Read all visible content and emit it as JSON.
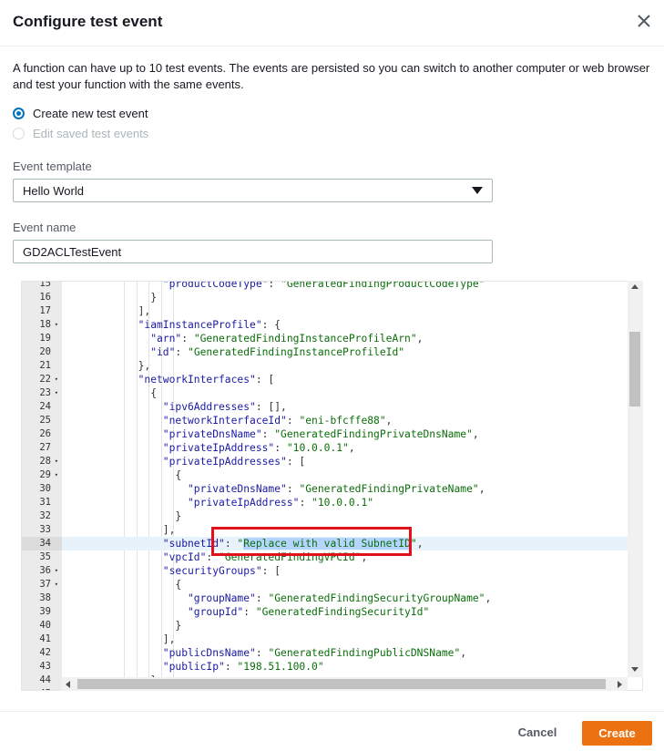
{
  "header": {
    "title": "Configure test event"
  },
  "description": "A function can have up to 10 test events. The events are persisted so you can switch to another computer or web browser and test your function with the same events.",
  "options": {
    "create_new": "Create new test event",
    "edit_saved": "Edit saved test events"
  },
  "template": {
    "label": "Event template",
    "value": "Hello World"
  },
  "event_name": {
    "label": "Event name",
    "value": "GD2ACLTestEvent"
  },
  "editor": {
    "active_line": 34,
    "lines": [
      {
        "n": 15,
        "indent": 8,
        "fold": false,
        "code": [
          [
            "k",
            "\"productCodeType\""
          ],
          [
            "p",
            ": "
          ],
          [
            "s",
            "\"GeneratedFindingProductCodeType\""
          ]
        ]
      },
      {
        "n": 16,
        "indent": 7,
        "fold": false,
        "code": [
          [
            "p",
            "}"
          ]
        ]
      },
      {
        "n": 17,
        "indent": 6,
        "fold": false,
        "code": [
          [
            "p",
            "],"
          ]
        ]
      },
      {
        "n": 18,
        "indent": 6,
        "fold": true,
        "code": [
          [
            "k",
            "\"iamInstanceProfile\""
          ],
          [
            "p",
            ": {"
          ]
        ]
      },
      {
        "n": 19,
        "indent": 7,
        "fold": false,
        "code": [
          [
            "k",
            "\"arn\""
          ],
          [
            "p",
            ": "
          ],
          [
            "s",
            "\"GeneratedFindingInstanceProfileArn\""
          ],
          [
            "p",
            ","
          ]
        ]
      },
      {
        "n": 20,
        "indent": 7,
        "fold": false,
        "code": [
          [
            "k",
            "\"id\""
          ],
          [
            "p",
            ": "
          ],
          [
            "s",
            "\"GeneratedFindingInstanceProfileId\""
          ]
        ]
      },
      {
        "n": 21,
        "indent": 6,
        "fold": false,
        "code": [
          [
            "p",
            "},"
          ]
        ]
      },
      {
        "n": 22,
        "indent": 6,
        "fold": true,
        "code": [
          [
            "k",
            "\"networkInterfaces\""
          ],
          [
            "p",
            ": ["
          ]
        ]
      },
      {
        "n": 23,
        "indent": 7,
        "fold": true,
        "code": [
          [
            "p",
            "{"
          ]
        ]
      },
      {
        "n": 24,
        "indent": 8,
        "fold": false,
        "code": [
          [
            "k",
            "\"ipv6Addresses\""
          ],
          [
            "p",
            ": [],"
          ]
        ]
      },
      {
        "n": 25,
        "indent": 8,
        "fold": false,
        "code": [
          [
            "k",
            "\"networkInterfaceId\""
          ],
          [
            "p",
            ": "
          ],
          [
            "s",
            "\"eni-bfcffe88\""
          ],
          [
            "p",
            ","
          ]
        ]
      },
      {
        "n": 26,
        "indent": 8,
        "fold": false,
        "code": [
          [
            "k",
            "\"privateDnsName\""
          ],
          [
            "p",
            ": "
          ],
          [
            "s",
            "\"GeneratedFindingPrivateDnsName\""
          ],
          [
            "p",
            ","
          ]
        ]
      },
      {
        "n": 27,
        "indent": 8,
        "fold": false,
        "code": [
          [
            "k",
            "\"privateIpAddress\""
          ],
          [
            "p",
            ": "
          ],
          [
            "s",
            "\"10.0.0.1\""
          ],
          [
            "p",
            ","
          ]
        ]
      },
      {
        "n": 28,
        "indent": 8,
        "fold": true,
        "code": [
          [
            "k",
            "\"privateIpAddresses\""
          ],
          [
            "p",
            ": ["
          ]
        ]
      },
      {
        "n": 29,
        "indent": 9,
        "fold": true,
        "code": [
          [
            "p",
            "{"
          ]
        ]
      },
      {
        "n": 30,
        "indent": 10,
        "fold": false,
        "code": [
          [
            "k",
            "\"privateDnsName\""
          ],
          [
            "p",
            ": "
          ],
          [
            "s",
            "\"GeneratedFindingPrivateName\""
          ],
          [
            "p",
            ","
          ]
        ]
      },
      {
        "n": 31,
        "indent": 10,
        "fold": false,
        "code": [
          [
            "k",
            "\"privateIpAddress\""
          ],
          [
            "p",
            ": "
          ],
          [
            "s",
            "\"10.0.0.1\""
          ]
        ]
      },
      {
        "n": 32,
        "indent": 9,
        "fold": false,
        "code": [
          [
            "p",
            "}"
          ]
        ]
      },
      {
        "n": 33,
        "indent": 8,
        "fold": false,
        "code": [
          [
            "p",
            "],"
          ]
        ]
      },
      {
        "n": 34,
        "indent": 8,
        "fold": false,
        "code": [
          [
            "k",
            "\"subnetId\""
          ],
          [
            "p",
            ": "
          ],
          [
            "s",
            "\""
          ],
          [
            "sel",
            "Replace with valid SubnetID"
          ],
          [
            "s",
            "\""
          ],
          [
            "p",
            ","
          ]
        ]
      },
      {
        "n": 35,
        "indent": 8,
        "fold": false,
        "code": [
          [
            "k",
            "\"vpcId\""
          ],
          [
            "p",
            ": "
          ],
          [
            "s",
            "\"GeneratedFindingVPCId\""
          ],
          [
            "p",
            ","
          ]
        ]
      },
      {
        "n": 36,
        "indent": 8,
        "fold": true,
        "code": [
          [
            "k",
            "\"securityGroups\""
          ],
          [
            "p",
            ": ["
          ]
        ]
      },
      {
        "n": 37,
        "indent": 9,
        "fold": true,
        "code": [
          [
            "p",
            "{"
          ]
        ]
      },
      {
        "n": 38,
        "indent": 10,
        "fold": false,
        "code": [
          [
            "k",
            "\"groupName\""
          ],
          [
            "p",
            ": "
          ],
          [
            "s",
            "\"GeneratedFindingSecurityGroupName\""
          ],
          [
            "p",
            ","
          ]
        ]
      },
      {
        "n": 39,
        "indent": 10,
        "fold": false,
        "code": [
          [
            "k",
            "\"groupId\""
          ],
          [
            "p",
            ": "
          ],
          [
            "s",
            "\"GeneratedFindingSecurityId\""
          ]
        ]
      },
      {
        "n": 40,
        "indent": 9,
        "fold": false,
        "code": [
          [
            "p",
            "}"
          ]
        ]
      },
      {
        "n": 41,
        "indent": 8,
        "fold": false,
        "code": [
          [
            "p",
            "],"
          ]
        ]
      },
      {
        "n": 42,
        "indent": 8,
        "fold": false,
        "code": [
          [
            "k",
            "\"publicDnsName\""
          ],
          [
            "p",
            ": "
          ],
          [
            "s",
            "\"GeneratedFindingPublicDNSName\""
          ],
          [
            "p",
            ","
          ]
        ]
      },
      {
        "n": 43,
        "indent": 8,
        "fold": false,
        "code": [
          [
            "k",
            "\"publicIp\""
          ],
          [
            "p",
            ": "
          ],
          [
            "s",
            "\"198.51.100.0\""
          ]
        ]
      },
      {
        "n": 44,
        "indent": 7,
        "fold": false,
        "code": [
          [
            "p",
            "}"
          ]
        ]
      },
      {
        "n": 45,
        "indent": 6,
        "fold": false,
        "code": [
          [
            "p",
            "],"
          ]
        ]
      }
    ]
  },
  "footer": {
    "cancel": "Cancel",
    "create": "Create"
  },
  "colors": {
    "accent": "#0073bb",
    "primary_button": "#ec7211",
    "highlight_box": "#e0111b"
  }
}
